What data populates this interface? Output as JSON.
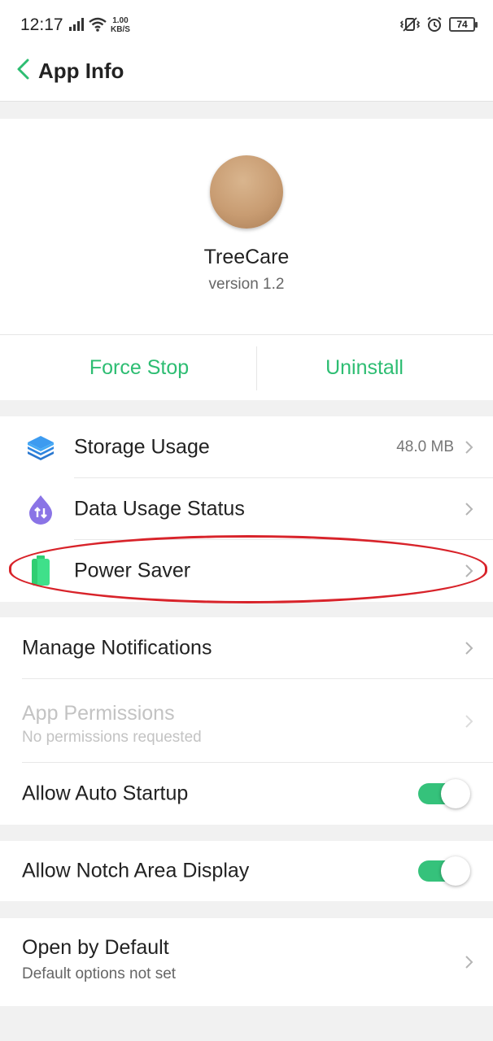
{
  "status_bar": {
    "time": "12:17",
    "net_speed_value": "1.00",
    "net_speed_unit": "KB/S",
    "battery": "74"
  },
  "app_bar": {
    "title": "App Info"
  },
  "app": {
    "name": "TreeCare",
    "version": "version 1.2"
  },
  "actions": {
    "force_stop": "Force Stop",
    "uninstall": "Uninstall"
  },
  "usage": {
    "storage": {
      "label": "Storage Usage",
      "value": "48.0 MB"
    },
    "data": {
      "label": "Data Usage Status"
    },
    "power": {
      "label": "Power Saver"
    }
  },
  "settings": {
    "notifications": {
      "label": "Manage Notifications"
    },
    "permissions": {
      "label": "App Permissions",
      "sublabel": "No permissions requested"
    },
    "auto_startup": {
      "label": "Allow Auto Startup",
      "enabled": true
    }
  },
  "notch": {
    "label": "Allow Notch Area Display",
    "enabled": true
  },
  "defaults": {
    "label": "Open by Default",
    "sublabel": "Default options not set"
  },
  "colors": {
    "accent": "#2dbd72",
    "toggle_on": "#35c27b",
    "highlight": "#d8232a"
  },
  "icons": {
    "storage": "layers-icon",
    "data": "data-drop-icon",
    "power": "battery-icon"
  }
}
